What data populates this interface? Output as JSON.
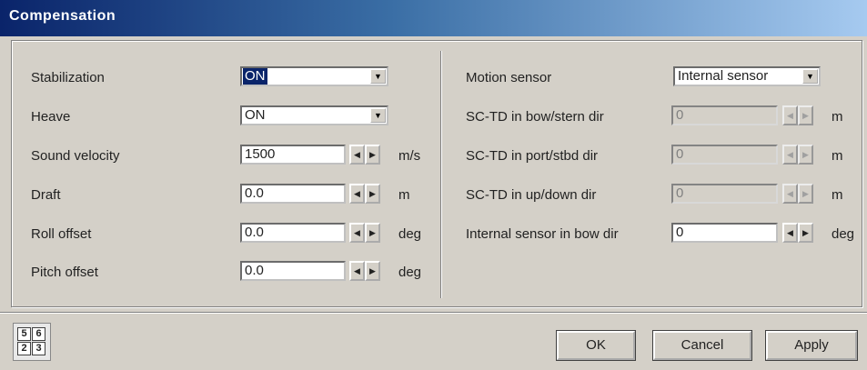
{
  "title": "Compensation",
  "left": {
    "stabilization": {
      "label": "Stabilization",
      "value": "ON"
    },
    "heave": {
      "label": "Heave",
      "value": "ON"
    },
    "sound_velocity": {
      "label": "Sound velocity",
      "value": "1500",
      "unit": "m/s"
    },
    "draft": {
      "label": "Draft",
      "value": "0.0",
      "unit": "m"
    },
    "roll_offset": {
      "label": "Roll offset",
      "value": "0.0",
      "unit": "deg"
    },
    "pitch_offset": {
      "label": "Pitch offset",
      "value": "0.0",
      "unit": "deg"
    }
  },
  "right": {
    "motion_sensor": {
      "label": "Motion sensor",
      "value": "Internal sensor"
    },
    "sctd_bow_stern": {
      "label": "SC-TD in bow/stern dir",
      "value": "0",
      "unit": "m"
    },
    "sctd_port_stbd": {
      "label": "SC-TD in port/stbd dir",
      "value": "0",
      "unit": "m"
    },
    "sctd_up_down": {
      "label": "SC-TD in up/down dir",
      "value": "0",
      "unit": "m"
    },
    "internal_bow": {
      "label": "Internal sensor in bow dir",
      "value": "0",
      "unit": "deg"
    }
  },
  "footer": {
    "ok_label": "OK",
    "cancel_label": "Cancel",
    "apply_label": "Apply",
    "layout_icon_digits": [
      "5",
      "6",
      "2",
      "3"
    ]
  }
}
